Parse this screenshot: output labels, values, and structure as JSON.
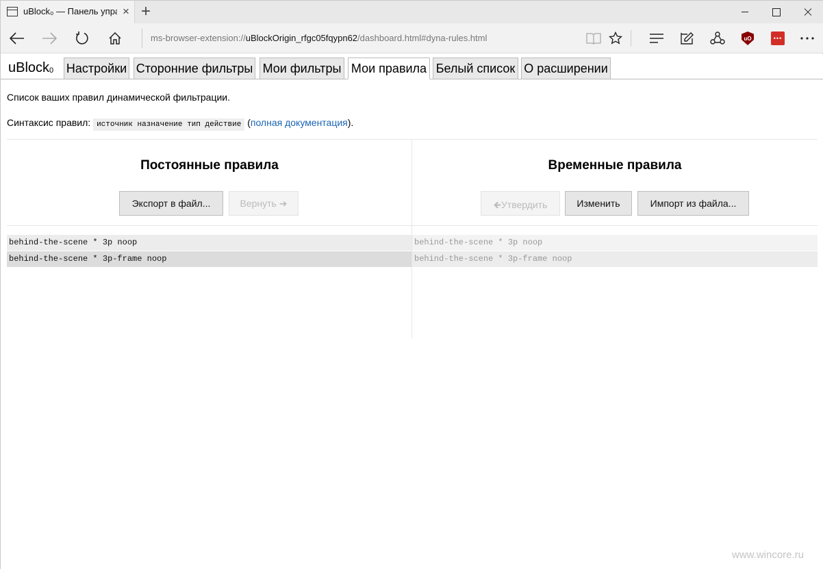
{
  "browser": {
    "tab_title": "uBlock₀ — Панель упра",
    "tab_close": "×",
    "new_tab": "+",
    "address": {
      "scheme": "ms-browser-extension://",
      "host": "uBlockOrigin_rfgc05fqypn62",
      "path": "/dashboard.html#dyna-rules.html"
    },
    "extensions": {
      "ublock_label": "uO",
      "lastpass_label": "•••"
    }
  },
  "dashboard": {
    "logo_main": "uBlock",
    "logo_sub": "0",
    "tabs": [
      {
        "label": "Настройки"
      },
      {
        "label": "Сторонние фильтры"
      },
      {
        "label": "Мои фильтры"
      },
      {
        "label": "Мои правила",
        "active": true
      },
      {
        "label": "Белый список"
      },
      {
        "label": "О расширении"
      }
    ]
  },
  "content": {
    "intro": "Список ваших правил динамической фильтрации.",
    "syntax_label": "Синтаксис правил:",
    "syntax_code": "источник назначение тип действие",
    "syntax_paren_open": "(",
    "doc_link": "полная документация",
    "syntax_paren_close": ")."
  },
  "permanent": {
    "title": "Постоянные правила",
    "export_button": "Экспорт в файл...",
    "revert_button": "Вернуть",
    "rules": [
      "behind-the-scene * 3p noop",
      "behind-the-scene * 3p-frame noop"
    ]
  },
  "temporary": {
    "title": "Временные правила",
    "commit_button": "Утвердить",
    "edit_button": "Изменить",
    "import_button": "Импорт из файла...",
    "rules": [
      "behind-the-scene * 3p noop",
      "behind-the-scene * 3p-frame noop"
    ]
  },
  "watermark": "www.wincore.ru",
  "icons": {
    "back": "back-arrow-icon",
    "forward": "forward-arrow-icon",
    "refresh": "refresh-icon",
    "home": "home-icon",
    "reading_view": "reading-view-icon",
    "favorite": "star-icon",
    "hub": "hub-icon",
    "notes": "web-note-icon",
    "share": "share-icon"
  }
}
